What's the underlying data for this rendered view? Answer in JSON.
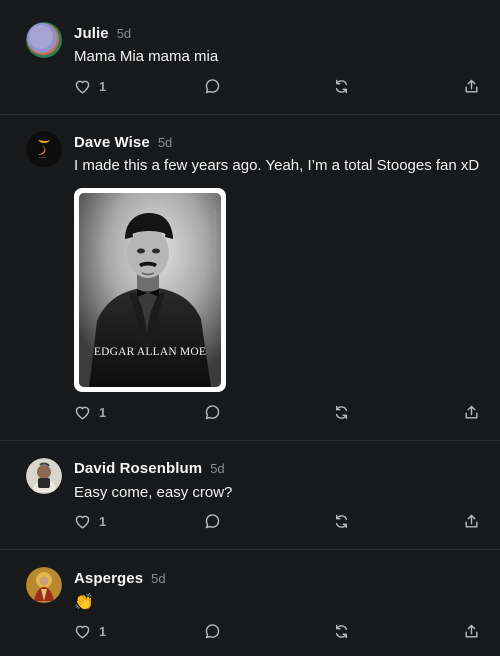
{
  "posts": [
    {
      "author": "Julie",
      "time": "5d",
      "text": "Mama Mia mama mia",
      "likes": "1",
      "avatar_colors": [
        "#8f93c9",
        "#d46a4a",
        "#3a9a6a"
      ]
    },
    {
      "author": "Dave Wise",
      "time": "5d",
      "text": "I made this a few years ago. Yeah, I’m a total Stooges fan xD",
      "likes": "1",
      "image_caption": "EDGAR ALLAN MOE"
    },
    {
      "author": "David Rosenblum",
      "time": "5d",
      "text": "Easy come, easy crow?",
      "likes": "1"
    },
    {
      "author": "Asperges",
      "time": "5d",
      "text": "👏",
      "likes": "1"
    }
  ],
  "icons": {
    "like": "heart-icon",
    "reply": "comment-icon",
    "restack": "restack-icon",
    "share": "share-icon"
  }
}
